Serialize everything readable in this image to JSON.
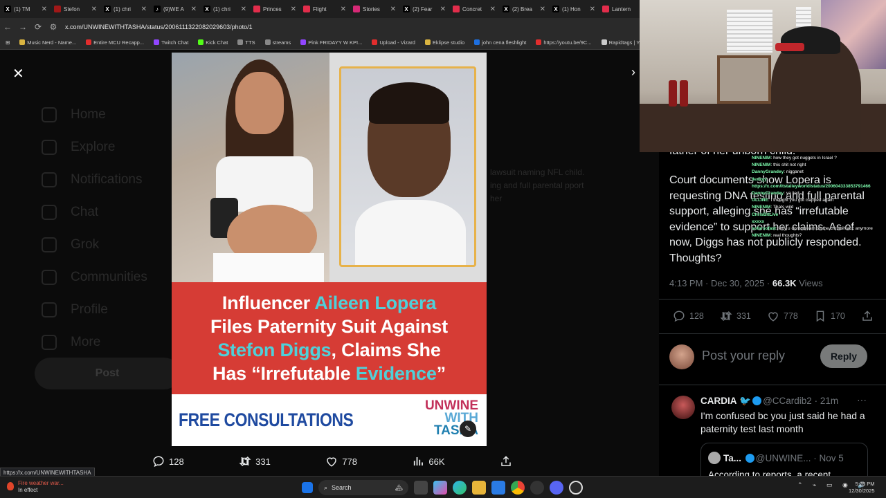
{
  "browser": {
    "tabs": [
      {
        "label": "(1) TM",
        "color": "#000000",
        "glyph": "X"
      },
      {
        "label": "Stefon",
        "color": "#a01818",
        "glyph": ""
      },
      {
        "label": "(1) chri",
        "color": "#000000",
        "glyph": "X"
      },
      {
        "label": "(9)WE A",
        "color": "#000000",
        "glyph": "♪"
      },
      {
        "label": "(1) chri",
        "color": "#000000",
        "glyph": "X"
      },
      {
        "label": "Princes",
        "color": "#e22d4b",
        "glyph": ""
      },
      {
        "label": "Flight",
        "color": "#e22d4b",
        "glyph": ""
      },
      {
        "label": "Stories",
        "color": "#d62976",
        "glyph": ""
      },
      {
        "label": "(2) Fear",
        "color": "#000000",
        "glyph": "X"
      },
      {
        "label": "Concret",
        "color": "#e22d4b",
        "glyph": ""
      },
      {
        "label": "(2) Brea",
        "color": "#000000",
        "glyph": "X"
      },
      {
        "label": "(1) Hon",
        "color": "#000000",
        "glyph": "X"
      },
      {
        "label": "Lantern",
        "color": "#e22d4b",
        "glyph": ""
      }
    ],
    "url": "x.com/UNWINEWITHTASHA/status/2006111322082029603/photo/1",
    "bookmarks": [
      {
        "label": "Music Nerd - Name...",
        "color": "#d9b441"
      },
      {
        "label": "Entire MCU Recapp...",
        "color": "#e22d2d"
      },
      {
        "label": "Twitch Chat",
        "color": "#9146ff"
      },
      {
        "label": "Kick Chat",
        "color": "#53fc18"
      },
      {
        "label": "TTS",
        "color": "#888888"
      },
      {
        "label": "streams",
        "color": "#888888"
      },
      {
        "label": "Pink FRIDAYY W KPI...",
        "color": "#9146ff"
      },
      {
        "label": "Upload - Vizard",
        "color": "#e22d2d"
      },
      {
        "label": "Eklipse studio",
        "color": "#d9b441"
      },
      {
        "label": "john cena fleshlight",
        "color": "#1d6fe0"
      },
      {
        "label": "https://youtu.be/9C...",
        "color": "#e22d2d"
      },
      {
        "label": "Rapidtags | You",
        "color": "#cccccc"
      }
    ],
    "status_url": "https://x.com/UNWINEWITHTASHA"
  },
  "viewer": {
    "close_icon": "close-icon",
    "next_icon": "chevron-right-icon",
    "bg_nav": [
      "Home",
      "Explore",
      "Notifications",
      "Chat",
      "Grok",
      "Communities",
      "Profile",
      "More"
    ],
    "bg_post_label": "Post",
    "bg_text": "lawsuit naming NFL child. ing and full parental pport her",
    "image": {
      "headline_l1_a": "Influencer ",
      "headline_l1_b": "Aileen Lopera",
      "headline_l2": "Files Paternity Suit Against",
      "headline_l3_a": "Stefon Diggs",
      "headline_l3_b": ", Claims She",
      "headline_l4_a": "Has “Irrefutable ",
      "headline_l4_b": "Evidence",
      "headline_l4_c": "”",
      "banner_left": "FREE CONSULTATIONS",
      "logo_l1": "UNWINE",
      "logo_l2": "WITH",
      "logo_l3": "TASHA"
    },
    "actions": {
      "replies": "128",
      "reposts": "331",
      "likes": "778",
      "views": "66K"
    }
  },
  "post": {
    "cut_line": "father of her unborn child.",
    "body": "Court documents show Lopera is requesting DNA testing and full parental support, alleging she has “irrefutable evidence” to support her claims. As of now, Diggs has not publicly responded. Thoughts?",
    "time": "4:13 PM · Dec 30, 2025",
    "views_count": "66.3K",
    "views_label": "Views",
    "replies": "128",
    "reposts": "331",
    "likes": "778",
    "bookmarks": "170",
    "reply_placeholder": "Post your reply",
    "reply_button": "Reply",
    "reply": {
      "name": "CARDIA",
      "handle": "@CCardib2",
      "age": "21m",
      "text": "I'm confused bc you just said he had a paternity test last month",
      "quote_name": "Ta...",
      "quote_handle": "@UNWINE...",
      "quote_date": "Nov 5",
      "quote_text": "According to reports, a recent"
    }
  },
  "chat": [
    {
      "user": "NINENIM",
      "msg": ": how they got nuggets in Israel ?"
    },
    {
      "user": "NINENIM",
      "msg": ": this shit not right"
    },
    {
      "user": "DannyGrandey",
      "msg": ": nigganet"
    },
    {
      "user": "llexkyy",
      "msg": ""
    },
    {
      "user": "https://x.com/itstalleyworld/status/200604333853791466",
      "msg": ""
    },
    {
      "user": "DannyGrandey",
      "msg": ": ya lied"
    },
    {
      "user": "OLLINE",
      "msg": ": I thought you got clapped again"
    },
    {
      "user": "NINENIM",
      "msg": ": Thats wild"
    },
    {
      "user": "ChrisBitLive",
      "msg": ""
    },
    {
      "user": "xxxxx",
      "msg": ""
    },
    {
      "user": "sofarsofast",
      "msg": ": why u dont stream on the chrisbih acc anymore"
    },
    {
      "user": "NINENIM",
      "msg": ": real thoughts?"
    }
  ],
  "taskbar": {
    "weather_l1": "Fire weather war...",
    "weather_l2": "In effect",
    "search": "Search",
    "time": "5:25 PM",
    "date": "12/30/2025"
  }
}
